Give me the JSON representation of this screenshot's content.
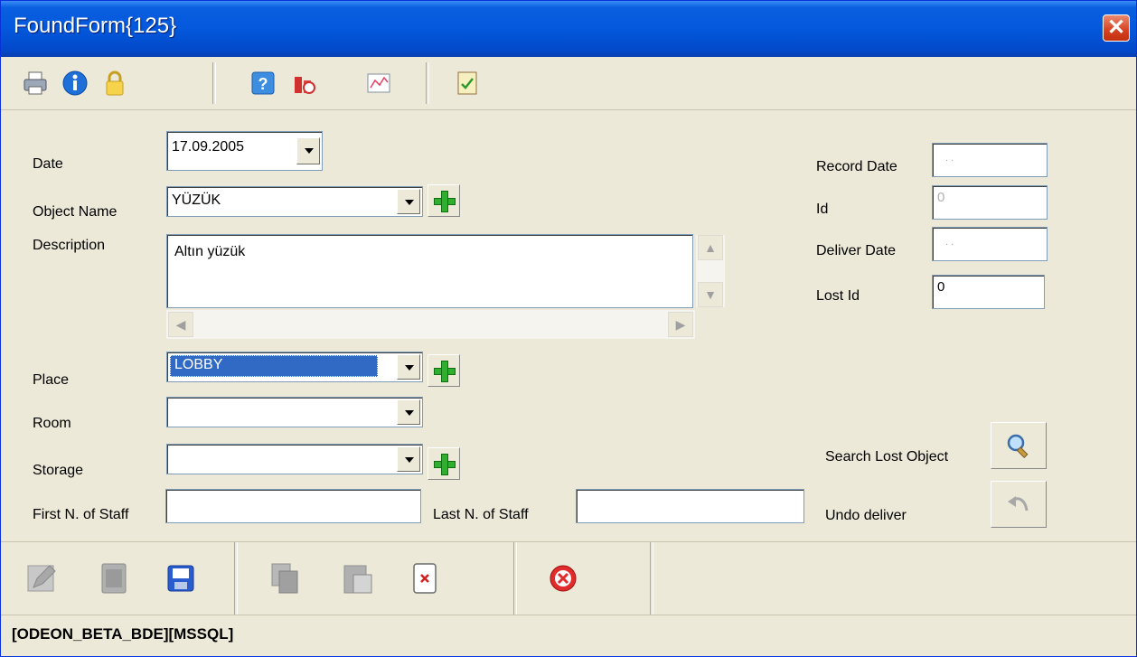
{
  "window": {
    "title": "FoundForm{125}"
  },
  "toolbar": {
    "icons": [
      "printer-icon",
      "info-icon",
      "lock-icon",
      "help-icon",
      "chart-delete-icon",
      "chart-icon",
      "report-icon"
    ]
  },
  "form": {
    "date": {
      "label": "Date",
      "value": "17.09.2005"
    },
    "object_name": {
      "label": "Object Name",
      "value": "YÜZÜK"
    },
    "description": {
      "label": "Description",
      "value": "Altın yüzük"
    },
    "place": {
      "label": "Place",
      "value": "LOBBY"
    },
    "room": {
      "label": "Room",
      "value": ""
    },
    "storage": {
      "label": "Storage",
      "value": ""
    },
    "first_name_staff": {
      "label": "First N. of Staff",
      "value": ""
    },
    "last_name_staff": {
      "label": "Last N. of Staff",
      "value": ""
    }
  },
  "side": {
    "record_date": {
      "label": "Record Date",
      "value": ". ."
    },
    "id": {
      "label": "Id",
      "value": "0"
    },
    "deliver_date": {
      "label": "Deliver Date",
      "value": ". ."
    },
    "lost_id": {
      "label": "Lost Id",
      "value": "0"
    },
    "search_lost": {
      "label": "Search Lost Object"
    },
    "undo_deliver": {
      "label": "Undo deliver"
    }
  },
  "bottombar": {
    "icons": [
      "edit-icon",
      "new-record-icon",
      "save-icon",
      "copy-icon",
      "paste-icon",
      "delete-icon",
      "cancel-icon"
    ]
  },
  "statusbar": {
    "text": "[ODEON_BETA_BDE][MSSQL]"
  },
  "colors": {
    "titlebar": "#0358dc",
    "window_bg": "#ece9d8",
    "selection": "#316ac5",
    "close": "#d6411f",
    "plus_green": "#2fae2f"
  }
}
